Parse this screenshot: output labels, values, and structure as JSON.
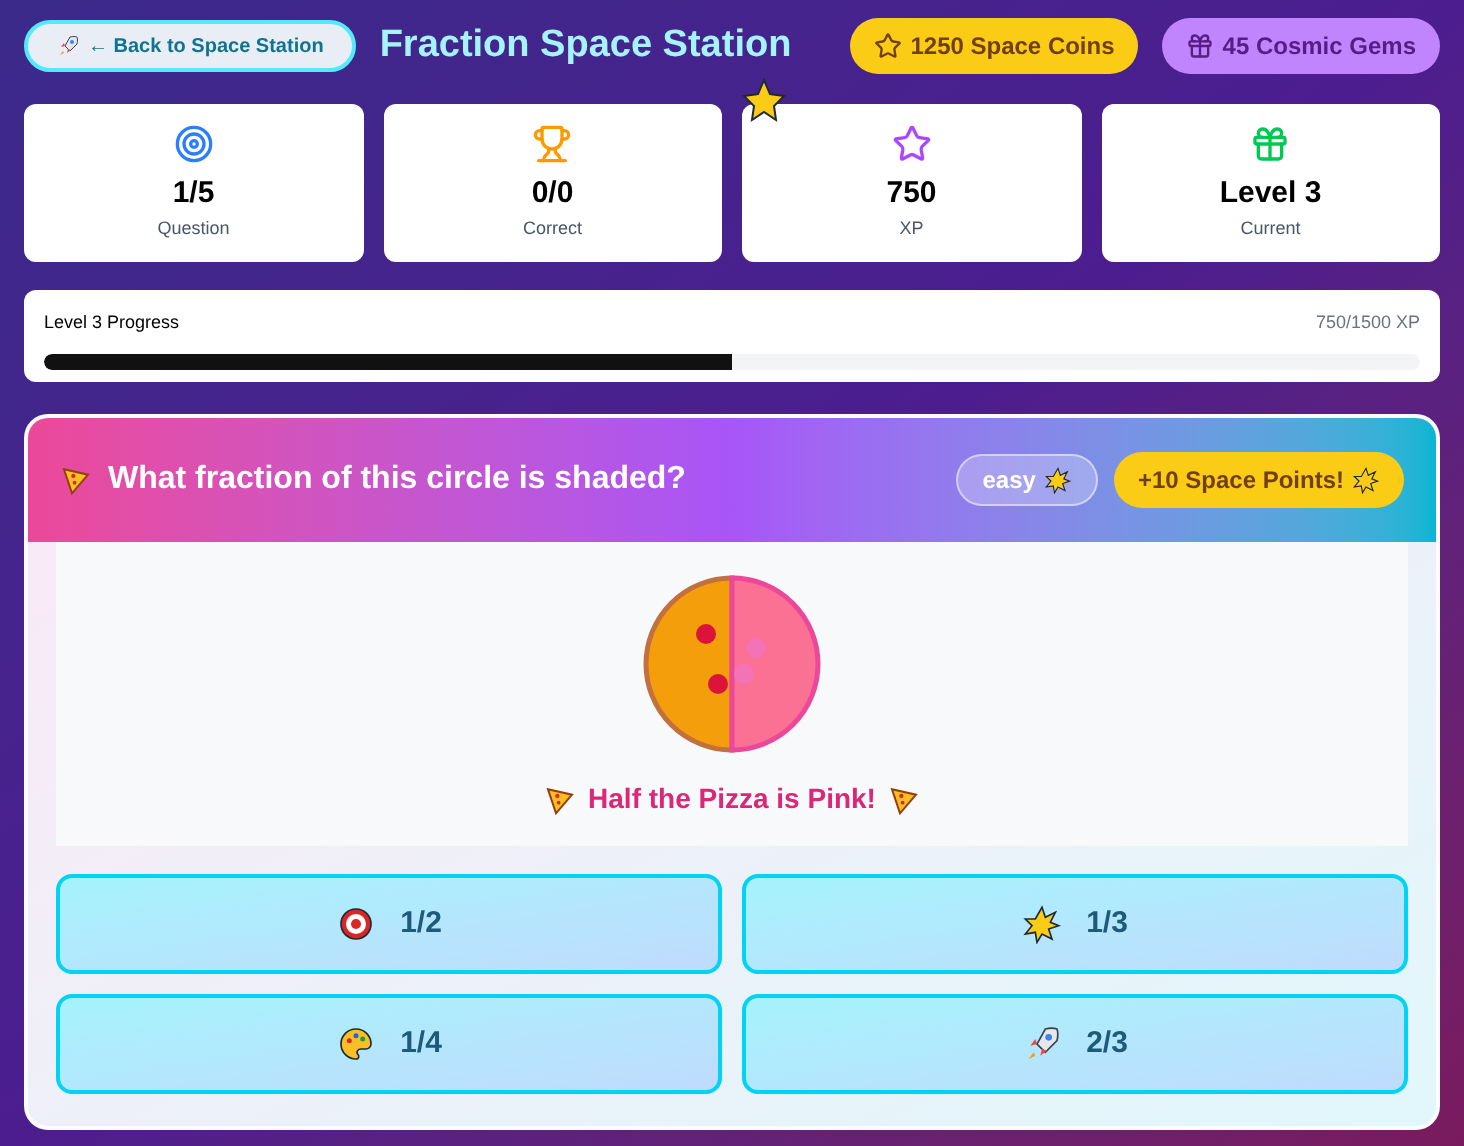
{
  "header": {
    "back_button": "← Back to Space Station",
    "title": "Fraction Space Station",
    "coins": "1250 Space Coins",
    "gems": "45 Cosmic Gems"
  },
  "stats": [
    {
      "kind": "target",
      "value": "1/5",
      "label": "Question"
    },
    {
      "kind": "trophy",
      "value": "0/0",
      "label": "Correct"
    },
    {
      "kind": "star",
      "value": "750",
      "label": "XP"
    },
    {
      "kind": "gift",
      "value": "Level 3",
      "label": "Current"
    }
  ],
  "progress": {
    "label": "Level 3 Progress",
    "reading": "750/1500 XP",
    "level": 0.5
  },
  "question": {
    "text": "What fraction of this circle is shaded?",
    "difficulty": "easy",
    "points": "+10 Space Points!",
    "caption": "Half the Pizza is Pink!"
  },
  "options": [
    {
      "label": "1/2",
      "selected": false
    },
    {
      "label": "1/3",
      "selected": false
    },
    {
      "label": "1/4",
      "selected": false
    },
    {
      "label": "2/3",
      "selected": false
    }
  ]
}
